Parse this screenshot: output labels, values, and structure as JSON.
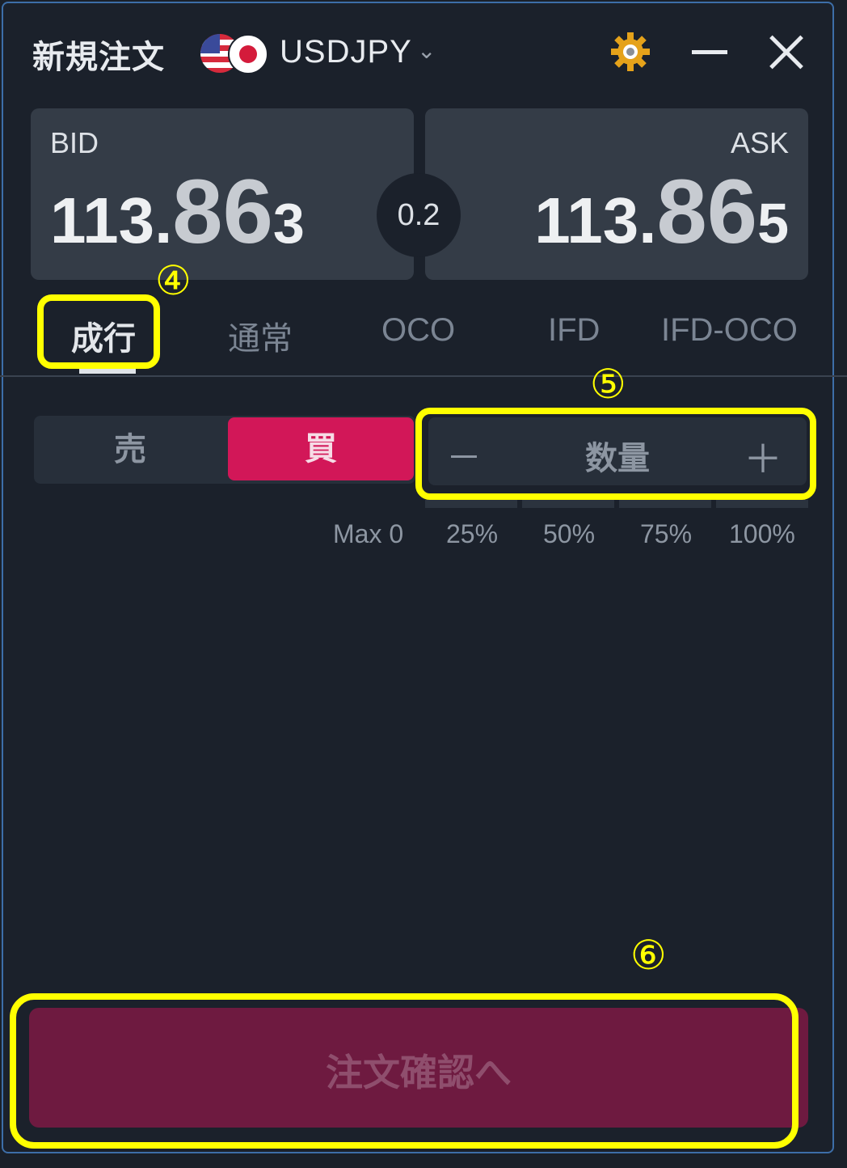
{
  "header": {
    "title": "新規注文",
    "symbol": "USDJPY"
  },
  "quote": {
    "bid": {
      "label": "BID",
      "main": "113.",
      "big": "86",
      "small": "3"
    },
    "ask": {
      "label": "ASK",
      "main": "113.",
      "big": "86",
      "small": "5"
    },
    "spread": "0.2"
  },
  "tabs": [
    "成行",
    "通常",
    "OCO",
    "IFD",
    "IFD-OCO"
  ],
  "side": {
    "sell": "売",
    "buy": "買"
  },
  "quantity": {
    "label": "数量",
    "minus": "－",
    "plus": "＋"
  },
  "max_label": "Max 0",
  "percent": [
    "25%",
    "50%",
    "75%",
    "100%"
  ],
  "confirm_label": "注文確認へ",
  "annotations": [
    "④",
    "⑤",
    "⑥"
  ],
  "colors": {
    "buy": "#d21758",
    "confirm": "#6e1a40",
    "highlight": "#ffff00"
  }
}
